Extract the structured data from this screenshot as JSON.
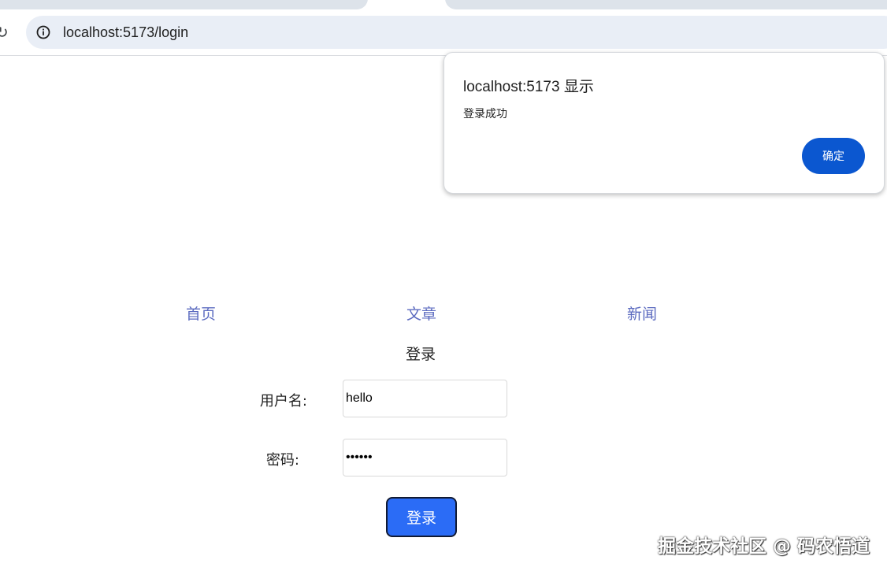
{
  "browser": {
    "url": "localhost:5173/login"
  },
  "dialog": {
    "title": "localhost:5173 显示",
    "message": "登录成功",
    "ok_label": "确定",
    "accent": "#0b57d0"
  },
  "nav": {
    "items": [
      {
        "label": "首页"
      },
      {
        "label": "文章"
      },
      {
        "label": "新闻"
      }
    ],
    "link_color": "#5c6bc0"
  },
  "login_form": {
    "heading": "登录",
    "username_label": "用户名:",
    "username_value": "hello",
    "password_label": "密码:",
    "password_value": "••••••",
    "submit_label": "登录",
    "submit_color": "#2b6cf6"
  },
  "watermark": "掘金技术社区 @ 码农悟道"
}
